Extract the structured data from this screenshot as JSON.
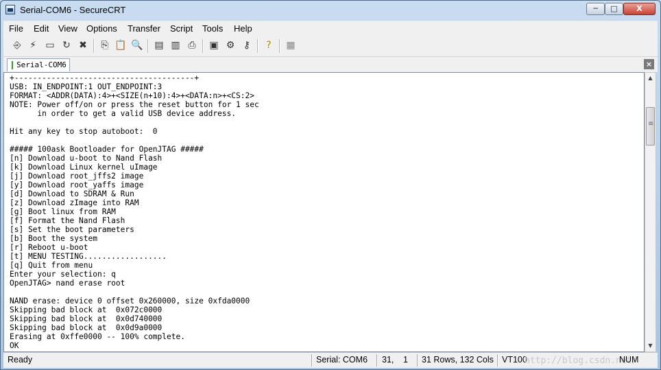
{
  "window": {
    "title": "Serial-COM6 - SecureCRT",
    "min_label": "─",
    "max_label": "□",
    "close_label": "X"
  },
  "menu": [
    "File",
    "Edit",
    "View",
    "Options",
    "Transfer",
    "Script",
    "Tools",
    "Help"
  ],
  "toolbar": {
    "icons": [
      "connect-icon",
      "quick-connect-icon",
      "connect-tab-icon",
      "reconnect-icon",
      "disconnect-icon",
      "copy-icon",
      "paste-icon",
      "find-icon",
      "print-screen-icon",
      "print-selection-icon",
      "print-icon",
      "session-options-icon",
      "global-options-icon",
      "keymap-icon",
      "help-icon",
      "sftp-icon"
    ]
  },
  "tab": {
    "label": "Serial-COM6",
    "close_label": "×"
  },
  "terminal": {
    "lines": [
      "+---------------------------------------+",
      "USB: IN_ENDPOINT:1 OUT_ENDPOINT:3",
      "FORMAT: <ADDR(DATA):4>+<SIZE(n+10):4>+<DATA:n>+<CS:2>",
      "NOTE: Power off/on or press the reset button for 1 sec",
      "      in order to get a valid USB device address.",
      "",
      "Hit any key to stop autoboot:  0",
      "",
      "##### 100ask Bootloader for OpenJTAG #####",
      "[n] Download u-boot to Nand Flash",
      "[k] Download Linux kernel uImage",
      "[j] Download root_jffs2 image",
      "[y] Download root_yaffs image",
      "[d] Download to SDRAM & Run",
      "[z] Download zImage into RAM",
      "[g] Boot linux from RAM",
      "[f] Format the Nand Flash",
      "[s] Set the boot parameters",
      "[b] Boot the system",
      "[r] Reboot u-boot",
      "[t] MENU TESTING..................",
      "[q] Quit from menu",
      "Enter your selection: q",
      "OpenJTAG> nand erase root",
      "",
      "NAND erase: device 0 offset 0x260000, size 0xfda0000",
      "Skipping bad block at  0x072c0000",
      "Skipping bad block at  0x0d740000",
      "Skipping bad block at  0x0d9a0000",
      "Erasing at 0xffe0000 -- 100% complete.",
      "OK"
    ]
  },
  "status": {
    "ready": "Ready",
    "connection": "Serial: COM6",
    "row": "31,",
    "col": "1",
    "size": "31 Rows, 132 Cols",
    "emulation": "VT100",
    "numlock": "NUM",
    "watermark": "http://blog.csdn.net/"
  }
}
